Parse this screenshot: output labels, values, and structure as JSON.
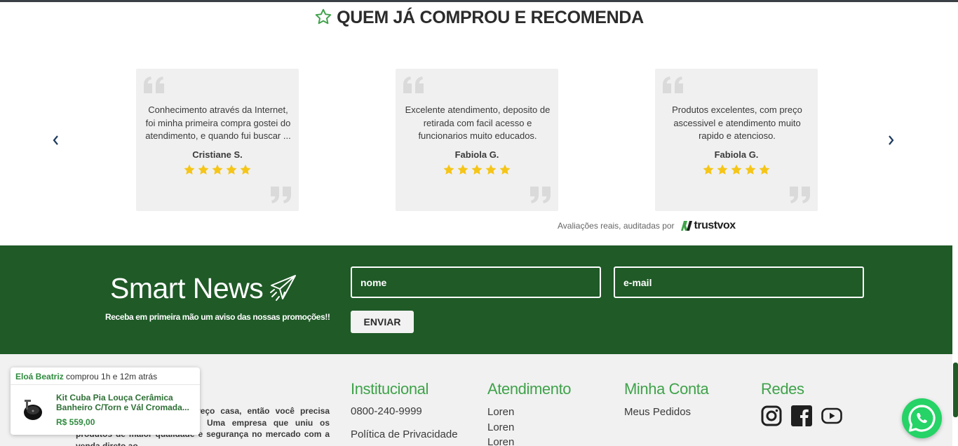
{
  "reviews": {
    "title": "QUEM JÁ COMPROU E RECOMENDA",
    "items": [
      {
        "text": "Conhecimento através da Internet, foi minha primeira compra gostei do atendimento, e quando fui buscar ...",
        "author": "Cristiane S.",
        "rating": 5
      },
      {
        "text": "Excelente atendimento, deposito de retirada com facil acesso e funcionarios muito educados.",
        "author": "Fabiola G.",
        "rating": 5
      },
      {
        "text": "Produtos excelentes, com preço ascessivel e atendimento muito rapido e atencioso.",
        "author": "Fabiola G.",
        "rating": 5
      }
    ],
    "audit_text": "Avaliações reais, auditadas por",
    "audit_brand": "trustvox"
  },
  "newsletter": {
    "title": "Smart News",
    "subtitle": "Receba em primeira mão um aviso das nossas promoções!!",
    "name_placeholder": "nome",
    "email_placeholder": "e-mail",
    "send_label": "ENVIAR"
  },
  "footer": {
    "about_head": "te",
    "about_text": "te para a sua obra, com preço casa, então você precisa conhecer a SMART NORTE. Uma empresa que uniu os produtos de maior qualidade e segurança no mercado com a venda direto ao",
    "institucional": {
      "head": "Institucional",
      "links": [
        "0800-240-9999",
        "Política de Privacidade"
      ]
    },
    "atendimento": {
      "head": "Atendimento",
      "links": [
        "Loren",
        "Loren",
        "Loren"
      ]
    },
    "minha_conta": {
      "head": "Minha Conta",
      "links": [
        "Meus Pedidos"
      ]
    },
    "redes": {
      "head": "Redes",
      "icons": [
        "instagram-icon",
        "facebook-icon",
        "youtube-icon"
      ]
    }
  },
  "toast": {
    "buyer": "Eloá Beatriz",
    "action": " comprou 1h e 12m atrás",
    "product": "Kit Cuba Pia Louça Cerâmica Banheiro C/Torn e Vál Cromada...",
    "price": "R$ 559,00"
  },
  "colors": {
    "accent_green": "#3fa24a",
    "news_bg": "#1f5a27",
    "star": "#f5c518",
    "whatsapp": "#25d366"
  }
}
